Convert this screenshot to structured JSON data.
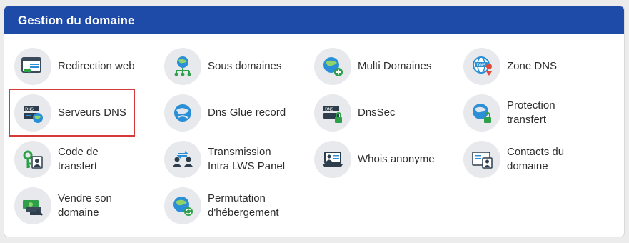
{
  "panel": {
    "title": "Gestion du domaine"
  },
  "colors": {
    "header": "#1e4aa8",
    "highlight": "#d43a3a",
    "globe": "#2a8fd6",
    "green": "#2fa04a"
  },
  "items": [
    {
      "label": "Redirection web",
      "icon": "browser-redirect-icon"
    },
    {
      "label": "Sous domaines",
      "icon": "globe-subdomains-icon"
    },
    {
      "label": "Multi Domaines",
      "icon": "globe-plus-icon"
    },
    {
      "label": "Zone DNS",
      "icon": "dns-globe-pin-icon"
    },
    {
      "label": "Serveurs DNS",
      "icon": "dns-server-icon",
      "highlighted": true
    },
    {
      "label": "Dns Glue record",
      "icon": "globe-glue-icon"
    },
    {
      "label": "DnsSec",
      "icon": "dns-lock-icon"
    },
    {
      "label": "Protection\ntransfert",
      "icon": "globe-lock-icon"
    },
    {
      "label": "Code de\ntransfert",
      "icon": "key-user-icon"
    },
    {
      "label": "Transmission\nIntra LWS Panel",
      "icon": "users-transfer-icon"
    },
    {
      "label": "Whois anonyme",
      "icon": "laptop-anonymous-icon"
    },
    {
      "label": "Contacts du\ndomaine",
      "icon": "contact-card-icon"
    },
    {
      "label": "Vendre son\ndomaine",
      "icon": "sell-money-icon"
    },
    {
      "label": "Permutation\nd'hébergement",
      "icon": "globe-swap-icon"
    }
  ]
}
